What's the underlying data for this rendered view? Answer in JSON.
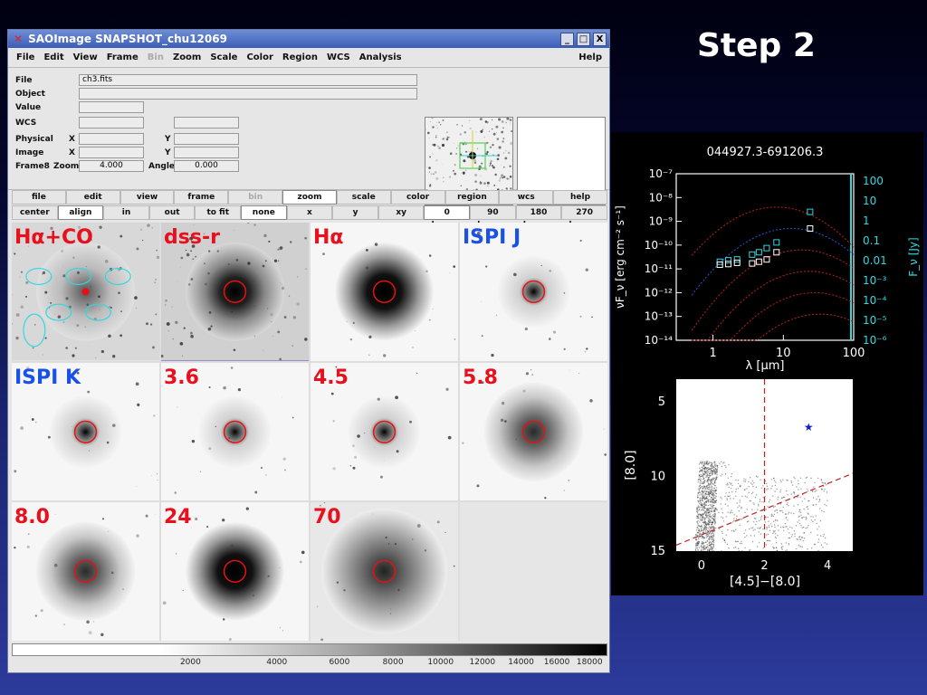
{
  "slide": {
    "title": "Step 2"
  },
  "window": {
    "title": "SAOImage SNAPSHOT_chu12069",
    "controls": [
      "_",
      "□",
      "X"
    ]
  },
  "menu": {
    "items": [
      "File",
      "Edit",
      "View",
      "Frame",
      "Bin",
      "Zoom",
      "Scale",
      "Color",
      "Region",
      "WCS",
      "Analysis"
    ],
    "disabled": [
      "Bin"
    ],
    "help": "Help"
  },
  "info": {
    "file_label": "File",
    "file_value": "ch3.fits",
    "object_label": "Object",
    "value_label": "Value",
    "wcs_label": "WCS",
    "physical_label": "Physical",
    "image_label": "Image",
    "frame_label": "Frame8",
    "zoom_label": "Zoom",
    "zoom_value": "4.000",
    "angle_label": "Angle",
    "angle_value": "0.000",
    "x_label": "X",
    "y_label": "Y"
  },
  "buttons": {
    "row1": [
      "file",
      "edit",
      "view",
      "frame",
      "bin",
      "zoom",
      "scale",
      "color",
      "region",
      "wcs",
      "help"
    ],
    "row1_active": "zoom",
    "row1_disabled": "bin",
    "row2": [
      "center",
      "align",
      "in",
      "out",
      "to fit",
      "none",
      "x",
      "y",
      "xy",
      "0 degrees",
      "90 degrees",
      "180 degrees",
      "270 degrees"
    ],
    "row2_active": [
      "align",
      "none",
      "0 degrees"
    ]
  },
  "frames": [
    {
      "label": "Hα+CO",
      "color": "red",
      "style": "field"
    },
    {
      "label": "dss-r",
      "color": "red",
      "style": "dss",
      "current": true
    },
    {
      "label": "Hα",
      "color": "red",
      "style": "blob"
    },
    {
      "label": "ISPI J",
      "color": "blue",
      "style": "point"
    },
    {
      "label": "ISPI K",
      "color": "blue",
      "style": "point"
    },
    {
      "label": "3.6",
      "color": "red",
      "style": "point"
    },
    {
      "label": "4.5",
      "color": "red",
      "style": "point"
    },
    {
      "label": "5.8",
      "color": "red",
      "style": "diffuse"
    },
    {
      "label": "8.0",
      "color": "red",
      "style": "diffuse"
    },
    {
      "label": "24",
      "color": "red",
      "style": "blob"
    },
    {
      "label": "70",
      "color": "red",
      "style": "pixel"
    }
  ],
  "colorbar": {
    "ticks": [
      "2000",
      "4000",
      "6000",
      "8000",
      "10000",
      "12000",
      "14000",
      "16000",
      "18000"
    ]
  },
  "chart_data": [
    {
      "type": "scatter",
      "title": "044927.3-691206.3",
      "xlabel": "λ [μm]",
      "ylabel": "νF_ν [erg cm⁻² s⁻¹]",
      "ylabel_right": "F_ν [Jy]",
      "x_scale": "log",
      "y_scale": "log",
      "xlim": [
        0.3,
        100
      ],
      "ylim": [
        1e-14,
        1e-07
      ],
      "x_ticks": [
        "1",
        "10",
        "100"
      ],
      "y_ticks": [
        "10⁻⁷",
        "10⁻⁸",
        "10⁻⁹",
        "10⁻¹⁰",
        "10⁻¹¹",
        "10⁻¹²",
        "10⁻¹³",
        "10⁻¹⁴"
      ],
      "y_ticks_right": [
        "100",
        "10",
        "1",
        "0.1",
        "0.01",
        "10⁻³",
        "10⁻⁴",
        "10⁻⁵",
        "10⁻⁶"
      ],
      "series": [
        {
          "marker": "cyan-square",
          "points": [
            [
              1.25,
              2e-11
            ],
            [
              1.65,
              2.3e-11
            ],
            [
              2.2,
              2.5e-11
            ],
            [
              3.6,
              4e-11
            ],
            [
              4.5,
              5e-11
            ],
            [
              5.8,
              7.5e-11
            ],
            [
              8.0,
              1.3e-10
            ],
            [
              24,
              2.5e-09
            ]
          ]
        },
        {
          "marker": "white-square",
          "points": [
            [
              1.25,
              1.5e-11
            ],
            [
              1.65,
              1.6e-11
            ],
            [
              2.2,
              1.8e-11
            ],
            [
              3.6,
              1.7e-11
            ],
            [
              4.5,
              2e-11
            ],
            [
              5.8,
              2.5e-11
            ],
            [
              8.0,
              5e-11
            ],
            [
              24,
              5e-10
            ]
          ]
        }
      ]
    },
    {
      "type": "scatter",
      "xlabel": "[4.5]−[8.0]",
      "ylabel": "[8.0]",
      "xlim": [
        -0.8,
        4.8
      ],
      "ylim": [
        15,
        3.5
      ],
      "x_ticks": [
        "0",
        "2",
        "4"
      ],
      "y_ticks": [
        "5",
        "10",
        "15"
      ],
      "vline": 2.0,
      "star": [
        3.4,
        6.7
      ]
    }
  ]
}
